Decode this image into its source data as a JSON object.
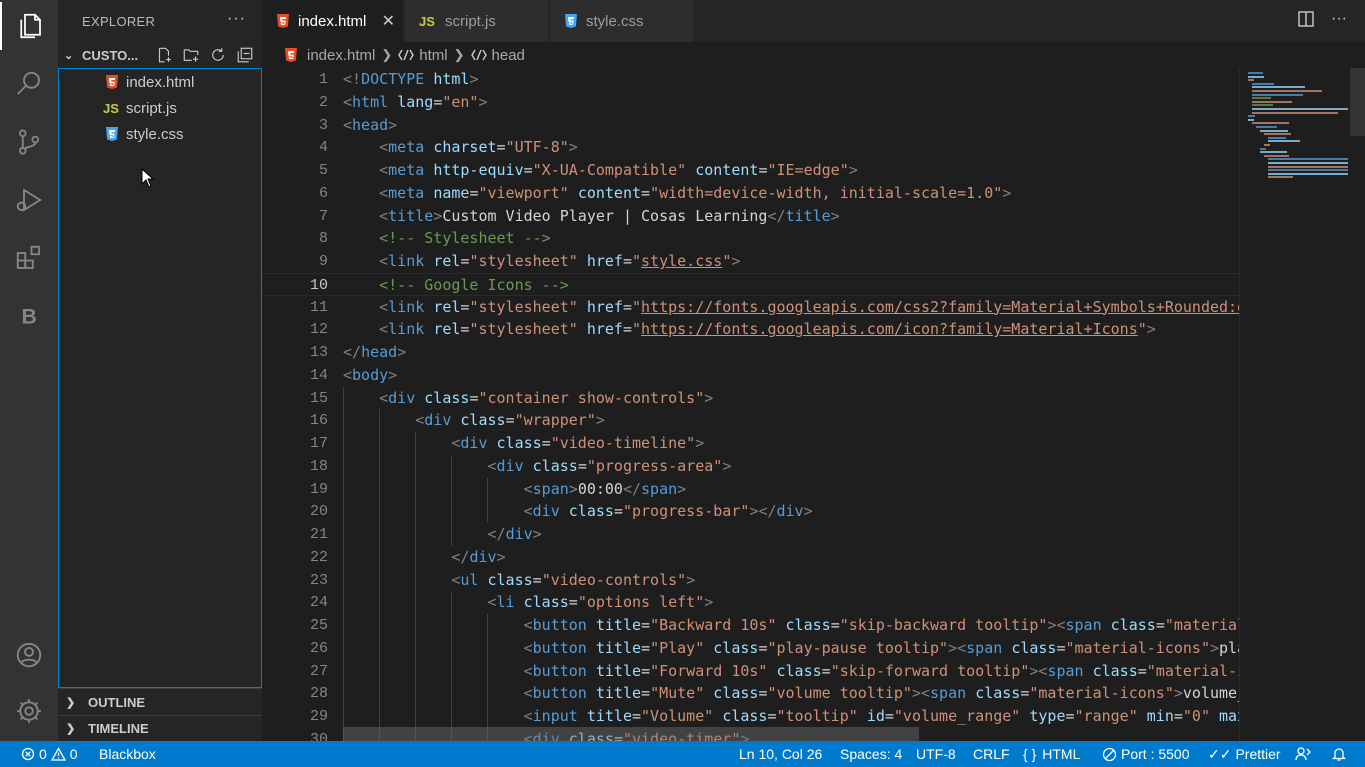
{
  "explorer": {
    "title": "EXPLORER",
    "more": "···",
    "folder": "CUSTO...",
    "files": [
      {
        "name": "index.html",
        "icon": "html5-icon"
      },
      {
        "name": "script.js",
        "icon": "js-icon"
      },
      {
        "name": "style.css",
        "icon": "css3-icon"
      }
    ],
    "outline": "OUTLINE",
    "timeline": "TIMELINE"
  },
  "tabs": [
    {
      "label": "index.html",
      "icon": "html5-icon",
      "active": true
    },
    {
      "label": "script.js",
      "icon": "js-icon",
      "active": false
    },
    {
      "label": "style.css",
      "icon": "css3-icon",
      "active": false
    }
  ],
  "breadcrumb": [
    "index.html",
    "html",
    "head"
  ],
  "code_lines": [
    {
      "n": "1",
      "text": "<!DOCTYPE html>"
    },
    {
      "n": "2",
      "text": "<html lang=\"en\">"
    },
    {
      "n": "3",
      "text": "<head>"
    },
    {
      "n": "4",
      "text": "    <meta charset=\"UTF-8\">"
    },
    {
      "n": "5",
      "text": "    <meta http-equiv=\"X-UA-Compatible\" content=\"IE=edge\">"
    },
    {
      "n": "6",
      "text": "    <meta name=\"viewport\" content=\"width=device-width, initial-scale=1.0\">"
    },
    {
      "n": "7",
      "text": "    <title>Custom Video Player | Cosas Learning</title>"
    },
    {
      "n": "8",
      "text": "    <!-- Stylesheet -->"
    },
    {
      "n": "9",
      "text": "    <link rel=\"stylesheet\" href=\"style.css\">"
    },
    {
      "n": "10",
      "text": "    <!-- Google Icons -->"
    },
    {
      "n": "11",
      "text": "    <link rel=\"stylesheet\" href=\"https://fonts.googleapis.com/css2?family=Material+Symbols+Rounded:o"
    },
    {
      "n": "12",
      "text": "    <link rel=\"stylesheet\" href=\"https://fonts.googleapis.com/icon?family=Material+Icons\">"
    },
    {
      "n": "13",
      "text": "</head>"
    },
    {
      "n": "14",
      "text": "<body>"
    },
    {
      "n": "15",
      "text": "    <div class=\"container show-controls\">"
    },
    {
      "n": "16",
      "text": "        <div class=\"wrapper\">"
    },
    {
      "n": "17",
      "text": "            <div class=\"video-timeline\">"
    },
    {
      "n": "18",
      "text": "                <div class=\"progress-area\">"
    },
    {
      "n": "19",
      "text": "                    <span>00:00</span>"
    },
    {
      "n": "20",
      "text": "                    <div class=\"progress-bar\"></div>"
    },
    {
      "n": "21",
      "text": "                </div>"
    },
    {
      "n": "22",
      "text": "            </div>"
    },
    {
      "n": "23",
      "text": "            <ul class=\"video-controls\">"
    },
    {
      "n": "24",
      "text": "                <li class=\"options left\">"
    },
    {
      "n": "25",
      "text": "                    <button title=\"Backward 10s\" class=\"skip-backward tooltip\"><span class=\"material"
    },
    {
      "n": "26",
      "text": "                    <button title=\"Play\" class=\"play-pause tooltip\"><span class=\"material-icons\">pla"
    },
    {
      "n": "27",
      "text": "                    <button title=\"Forward 10s\" class=\"skip-forward tooltip\"><span class=\"material-i"
    },
    {
      "n": "28",
      "text": "                    <button title=\"Mute\" class=\"volume tooltip\"><span class=\"material-icons\">volume_"
    },
    {
      "n": "29",
      "text": "                    <input title=\"Volume\" class=\"tooltip\" id=\"volume_range\" type=\"range\" min=\"0\" max"
    },
    {
      "n": "30",
      "text": "                    <div class=\"video-timer\">"
    }
  ],
  "current_line": "10",
  "status": {
    "errors": "0",
    "warnings": "0",
    "blackbox": "Blackbox",
    "position": "Ln 10, Col 26",
    "spaces": "Spaces: 4",
    "encoding": "UTF-8",
    "eol": "CRLF",
    "language": "HTML",
    "port": "Port : 5500",
    "prettier": "Prettier"
  },
  "colors": {
    "accent": "#007acc",
    "tag": "#569cd6",
    "attribute": "#9cdcfe",
    "string": "#ce9178",
    "comment": "#6a9955"
  }
}
